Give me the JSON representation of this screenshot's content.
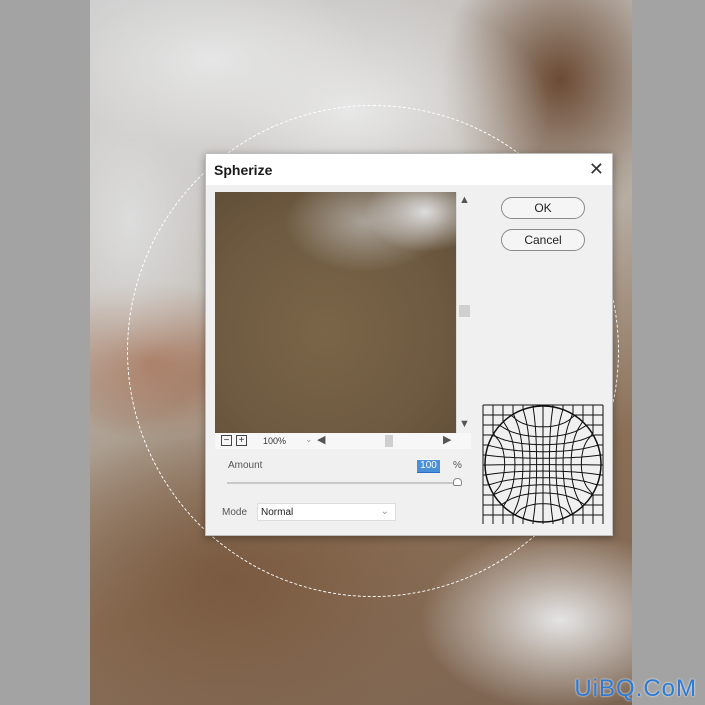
{
  "dialog": {
    "title": "Spherize",
    "ok_label": "OK",
    "cancel_label": "Cancel",
    "zoom": {
      "value": "100%",
      "minus": "−",
      "plus": "+"
    },
    "amount": {
      "label": "Amount",
      "value": "100",
      "unit": "%",
      "slider_percent": 100
    },
    "mode": {
      "label": "Mode",
      "value": "Normal"
    }
  },
  "watermark": "UiBQ.CoM"
}
